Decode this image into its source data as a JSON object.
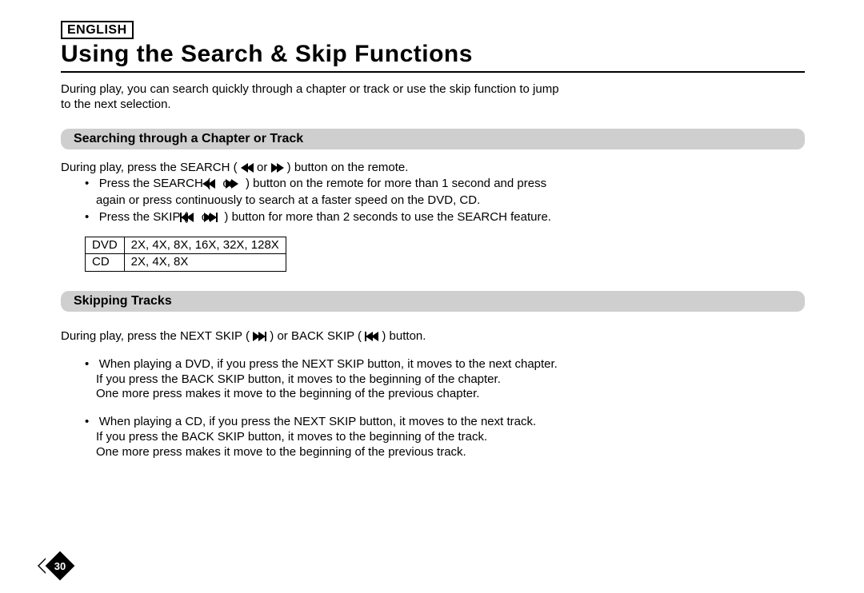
{
  "language_label": "ENGLISH",
  "title": "Using the Search & Skip Functions",
  "intro_line1": "During play, you can search quickly through a chapter or track or use the skip function to jump",
  "intro_line2": "to the next selection.",
  "section1": {
    "heading": "Searching through a Chapter or Track",
    "lead_a": "During play, press the SEARCH (",
    "lead_b": " or ",
    "lead_c": ") button on the remote.",
    "bullet1_a": "Press the SEARCH (",
    "bullet1_b": " or ",
    "bullet1_c": ") button on the remote for more than 1 second and press",
    "bullet1_line2": "again or press continuously to search at a faster speed on the DVD, CD.",
    "bullet2_a": "Press the SKIP (",
    "bullet2_b": " or ",
    "bullet2_c": ") button for more than 2 seconds to use the SEARCH feature.",
    "table": {
      "row1": {
        "c1": "DVD",
        "c2": "2X, 4X, 8X, 16X, 32X, 128X"
      },
      "row2": {
        "c1": "CD",
        "c2": "2X, 4X, 8X"
      }
    }
  },
  "section2": {
    "heading": "Skipping Tracks",
    "lead_a": "During play, press the NEXT SKIP (",
    "lead_b": ") or BACK SKIP (",
    "lead_c": ") button.",
    "dvd": {
      "l1": "When playing a DVD, if you press the NEXT SKIP button, it moves to the next chapter.",
      "l2": "If you press the BACK SKIP button, it moves to the beginning of the chapter.",
      "l3": "One more press makes it move to the beginning of the previous chapter."
    },
    "cd": {
      "l1": "When playing a CD, if you press the NEXT SKIP button, it moves to the next track.",
      "l2": "If you press the BACK SKIP button, it moves to the beginning of the track.",
      "l3": "One more press makes it move to the beginning of the previous track."
    }
  },
  "page_number": "30"
}
